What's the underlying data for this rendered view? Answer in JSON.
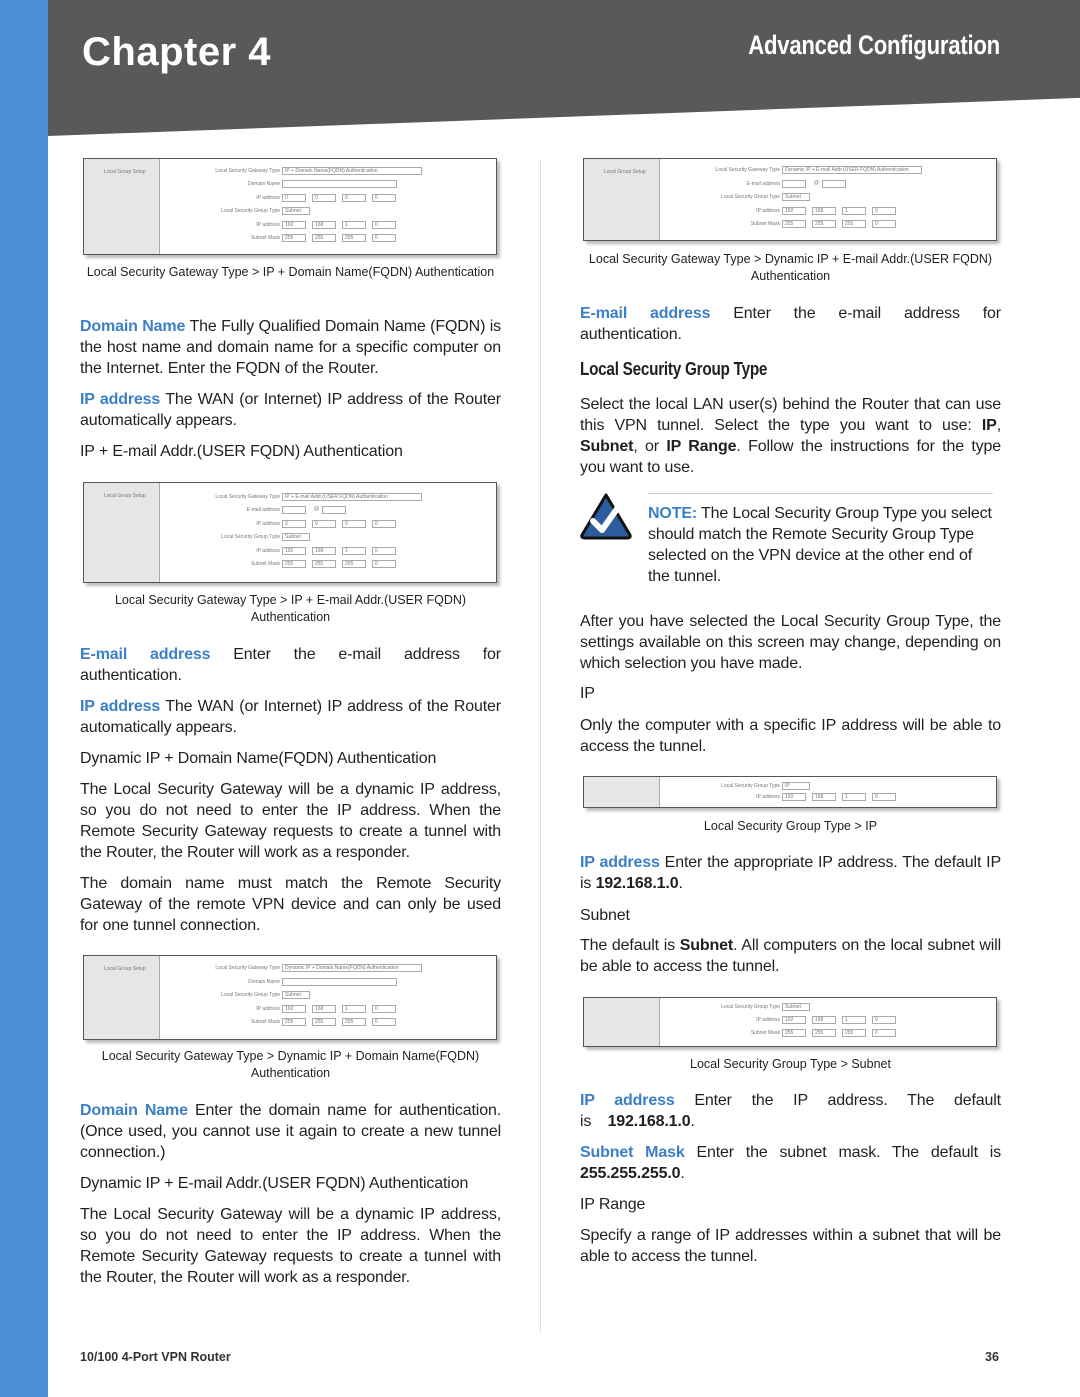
{
  "header": {
    "chapter": "Chapter 4",
    "section": "Advanced Configuration"
  },
  "colors": {
    "accent": "#3b7fc6",
    "strip": "#4a8ed6",
    "header": "#58595b"
  },
  "shots": [
    {
      "side": "Local Group Setup",
      "rows": [
        [
          "Local Security Gateway Type",
          [
            "IP + Domain Name(FQDN) Authentication"
          ]
        ],
        [
          "Domain Name",
          [
            ""
          ]
        ],
        [
          "IP address",
          [
            "0",
            "0",
            "0",
            "0"
          ]
        ],
        [
          "Local Security Group Type",
          [
            "Subnet"
          ]
        ],
        [
          "IP address",
          [
            "192",
            "168",
            "1",
            "0"
          ]
        ],
        [
          "Subnet Mask",
          [
            "255",
            "255",
            "255",
            "0"
          ]
        ]
      ]
    },
    {
      "side": "Local Group Setup",
      "rows": [
        [
          "Local Security Gateway Type",
          [
            "IP + E-mail Addr.(USER FQDN) Authentication"
          ]
        ],
        [
          "E-mail address",
          [
            "",
            "@",
            ""
          ]
        ],
        [
          "IP address",
          [
            "0",
            "0",
            "0",
            "0"
          ]
        ],
        [
          "Local Security Group Type",
          [
            "Subnet"
          ]
        ],
        [
          "IP address",
          [
            "192",
            "168",
            "1",
            "0"
          ]
        ],
        [
          "Subnet Mask",
          [
            "255",
            "255",
            "255",
            "0"
          ]
        ]
      ]
    },
    {
      "side": "Local Group Setup",
      "rows": [
        [
          "Local Security Gateway Type",
          [
            "Dynamic IP + Domain Name(FQDN) Authentication"
          ]
        ],
        [
          "Domain Name",
          [
            ""
          ]
        ],
        [
          "Local Security Group Type",
          [
            "Subnet"
          ]
        ],
        [
          "IP address",
          [
            "192",
            "168",
            "1",
            "0"
          ]
        ],
        [
          "Subnet Mask",
          [
            "255",
            "255",
            "255",
            "0"
          ]
        ]
      ]
    },
    {
      "side": "Local Group Setup",
      "rows": [
        [
          "Local Security Gateway Type",
          [
            "Dynamic IP + E-mail Addr.(USER FQDN) Authentication"
          ]
        ],
        [
          "E-mail address",
          [
            "",
            "@",
            ""
          ]
        ],
        [
          "Local Security Group Type",
          [
            "Subnet"
          ]
        ],
        [
          "IP address",
          [
            "192",
            "168",
            "1",
            "0"
          ]
        ],
        [
          "Subnet Mask",
          [
            "255",
            "255",
            "255",
            "0"
          ]
        ]
      ]
    },
    {
      "side": "",
      "rows": [
        [
          "Local Security Group Type",
          [
            "IP"
          ]
        ],
        [
          "IP address",
          [
            "192",
            "168",
            "1",
            "0"
          ]
        ]
      ]
    },
    {
      "side": "",
      "rows": [
        [
          "Local Security Group Type",
          [
            "Subnet"
          ]
        ],
        [
          "IP address",
          [
            "192",
            "168",
            "1",
            "0"
          ]
        ],
        [
          "Subnet Mask",
          [
            "255",
            "255",
            "255",
            "0"
          ]
        ]
      ]
    }
  ],
  "left": {
    "cap1": "Local Security Gateway Type > IP + Domain Name(FQDN) Authentication",
    "p1": {
      "lead": "Domain Name",
      "text": "  The Fully Qualified Domain Name (FQDN) is the host name and domain name for a specific computer on the Internet. Enter the FQDN of the Router."
    },
    "p2": {
      "lead": "IP address",
      "text": "  The WAN (or Internet) IP address of the Router automatically appears."
    },
    "p3": "IP + E-mail Addr.(USER FQDN) Authentication",
    "cap2": "Local Security Gateway Type > IP + E-mail Addr.(USER FQDN) Authentication",
    "p4": {
      "lead": "E-mail address",
      "text": " Enter the e-mail address for authentication."
    },
    "p5": {
      "lead": "IP address",
      "text": "  The WAN (or Internet) IP address of the Router automatically appears."
    },
    "p6": "Dynamic IP + Domain Name(FQDN) Authentication",
    "p7": "The Local Security Gateway will be a dynamic IP address, so you do not need to enter the IP address. When the Remote Security Gateway requests to create a tunnel with the Router, the Router will work as a responder.",
    "p8": "The domain name must match the Remote Security Gateway of the remote VPN device and can only be used for one tunnel connection.",
    "cap3": "Local Security Gateway Type > Dynamic IP + Domain Name(FQDN) Authentication",
    "p9": {
      "lead": "Domain Name",
      "text": " Enter the domain name for authentication. (Once used, you cannot use it again to create a new tunnel connection.)"
    },
    "p10": "Dynamic IP + E-mail Addr.(USER FQDN) Authentication",
    "p11": "The Local Security Gateway will be a dynamic IP address, so you do not need to enter the IP address. When the Remote Security Gateway requests to create a tunnel with the Router, the Router will work as a responder."
  },
  "right": {
    "cap4": "Local Security Gateway Type > Dynamic IP + E-mail Addr.(USER FQDN) Authentication",
    "p1": {
      "lead": "E-mail address",
      "text": " Enter the e-mail address for authentication."
    },
    "heading": "Local Security Group Type",
    "p2": {
      "a": "Select the local LAN user(s) behind the Router that can use this VPN tunnel. Select the type you want to use: ",
      "b1": "IP",
      "c": ", ",
      "b2": "Subnet",
      "d": ", or ",
      "b3": "IP Range",
      "e": ". Follow the instructions for the type you want to use."
    },
    "note": {
      "icon": "checkmark-icon",
      "lead": "NOTE:",
      "text": " The Local Security Group Type you select should match the Remote Security Group Type selected on the VPN device at the other end of the tunnel."
    },
    "p3": "After you have selected the Local Security Group Type, the settings available on this screen may change, depending on which selection you have made.",
    "p4": "IP",
    "p5": "Only the computer with a specific IP address will be able to access the tunnel.",
    "cap5": "Local Security Group Type > IP",
    "p6": {
      "lead": "IP address",
      "text": "  Enter the appropriate IP address. The default IP is ",
      "val": "192.168.1.0",
      "end": "."
    },
    "p7": "Subnet",
    "p8": {
      "a": "The default is ",
      "b": "Subnet",
      "c": ". All computers on the local subnet will be able to access the tunnel."
    },
    "cap6": "Local Security Group Type > Subnet",
    "p9": {
      "lead": "IP address",
      "text": " Enter the IP address. The default is ",
      "val": "192.168.1.0",
      "end": "."
    },
    "p10": {
      "lead": "Subnet Mask",
      "text": " Enter the subnet mask. The default is ",
      "val": "255.255.255.0",
      "end": "."
    },
    "p11": "IP Range",
    "p12": "Specify a range of IP addresses within a subnet that will be able to access the tunnel."
  },
  "footer": {
    "product": "10/100 4-Port VPN Router",
    "page": "36"
  }
}
